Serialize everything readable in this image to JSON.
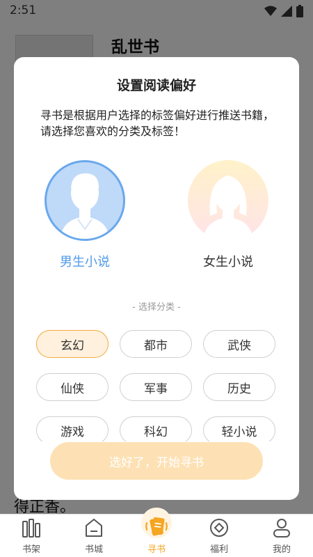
{
  "status_bar": {
    "time": "2:51"
  },
  "background": {
    "book_title": "乱世书",
    "snippet": "得正香。"
  },
  "modal": {
    "title": "设置阅读偏好",
    "description": "寻书是根据用户选择的标签偏好进行推送书籍， 请选择您喜欢的分类及标签！",
    "male_label": "男生小说",
    "female_label": "女生小说",
    "selected_gender": "male",
    "section_label": "- 选择分类 -",
    "tags": [
      {
        "label": "玄幻",
        "selected": true
      },
      {
        "label": "都市",
        "selected": false
      },
      {
        "label": "武侠",
        "selected": false
      },
      {
        "label": "仙侠",
        "selected": false
      },
      {
        "label": "军事",
        "selected": false
      },
      {
        "label": "历史",
        "selected": false
      },
      {
        "label": "游戏",
        "selected": false
      },
      {
        "label": "科幻",
        "selected": false
      },
      {
        "label": "轻小说",
        "selected": false
      }
    ],
    "start_button": "选好了，开始寻书"
  },
  "bottom_nav": {
    "items": [
      {
        "label": "书架",
        "icon": "bookshelf-icon",
        "active": false
      },
      {
        "label": "书城",
        "icon": "bookstore-icon",
        "active": false
      },
      {
        "label": "寻书",
        "icon": "find-book-icon",
        "active": true
      },
      {
        "label": "福利",
        "icon": "welfare-icon",
        "active": false
      },
      {
        "label": "我的",
        "icon": "profile-icon",
        "active": false
      }
    ]
  },
  "colors": {
    "accent": "#f5a623",
    "male_blue": "#4f9ae8",
    "tag_selected_border": "#f2a93b"
  }
}
